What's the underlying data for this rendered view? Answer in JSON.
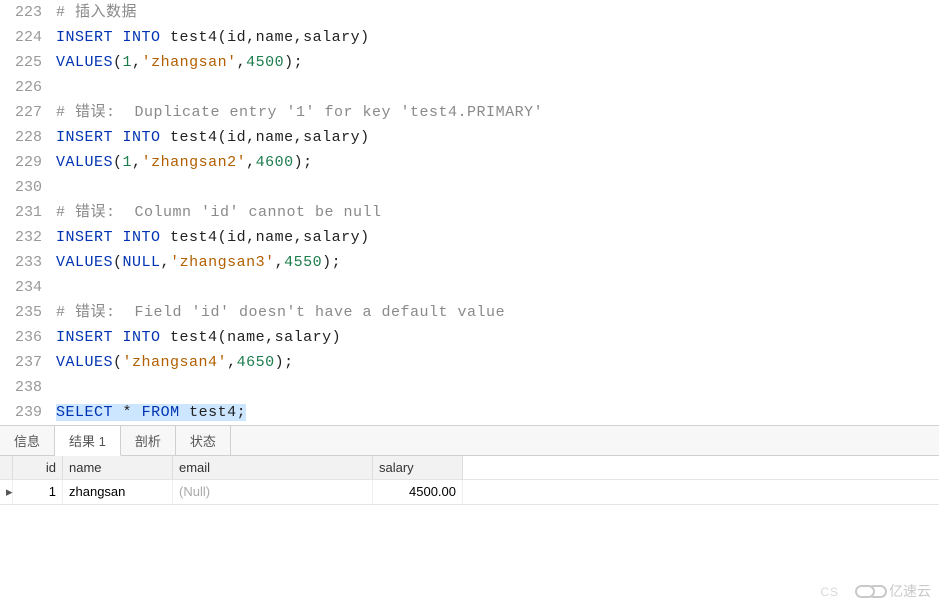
{
  "lines": [
    {
      "n": 223,
      "tokens": [
        {
          "t": "# 插入数据",
          "c": "cmt"
        }
      ]
    },
    {
      "n": 224,
      "tokens": [
        {
          "t": "INSERT",
          "c": "kw"
        },
        {
          "t": " ",
          "c": "pn"
        },
        {
          "t": "INTO",
          "c": "kw"
        },
        {
          "t": " test4",
          "c": "id"
        },
        {
          "t": "(",
          "c": "pn"
        },
        {
          "t": "id",
          "c": "id"
        },
        {
          "t": ",",
          "c": "pn"
        },
        {
          "t": "name",
          "c": "id"
        },
        {
          "t": ",",
          "c": "pn"
        },
        {
          "t": "salary",
          "c": "id"
        },
        {
          "t": ")",
          "c": "pn"
        }
      ]
    },
    {
      "n": 225,
      "tokens": [
        {
          "t": "VALUES",
          "c": "kw"
        },
        {
          "t": "(",
          "c": "pn"
        },
        {
          "t": "1",
          "c": "num"
        },
        {
          "t": ",",
          "c": "pn"
        },
        {
          "t": "'zhangsan'",
          "c": "str"
        },
        {
          "t": ",",
          "c": "pn"
        },
        {
          "t": "4500",
          "c": "num"
        },
        {
          "t": ");",
          "c": "pn"
        }
      ]
    },
    {
      "n": 226,
      "tokens": []
    },
    {
      "n": 227,
      "tokens": [
        {
          "t": "# 错误:  Duplicate entry '1' for key 'test4.PRIMARY'",
          "c": "cmt"
        }
      ]
    },
    {
      "n": 228,
      "tokens": [
        {
          "t": "INSERT",
          "c": "kw"
        },
        {
          "t": " ",
          "c": "pn"
        },
        {
          "t": "INTO",
          "c": "kw"
        },
        {
          "t": " test4",
          "c": "id"
        },
        {
          "t": "(",
          "c": "pn"
        },
        {
          "t": "id",
          "c": "id"
        },
        {
          "t": ",",
          "c": "pn"
        },
        {
          "t": "name",
          "c": "id"
        },
        {
          "t": ",",
          "c": "pn"
        },
        {
          "t": "salary",
          "c": "id"
        },
        {
          "t": ")",
          "c": "pn"
        }
      ]
    },
    {
      "n": 229,
      "tokens": [
        {
          "t": "VALUES",
          "c": "kw"
        },
        {
          "t": "(",
          "c": "pn"
        },
        {
          "t": "1",
          "c": "num"
        },
        {
          "t": ",",
          "c": "pn"
        },
        {
          "t": "'zhangsan2'",
          "c": "str"
        },
        {
          "t": ",",
          "c": "pn"
        },
        {
          "t": "4600",
          "c": "num"
        },
        {
          "t": ");",
          "c": "pn"
        }
      ]
    },
    {
      "n": 230,
      "tokens": []
    },
    {
      "n": 231,
      "tokens": [
        {
          "t": "# 错误:  Column 'id' cannot be null",
          "c": "cmt"
        }
      ]
    },
    {
      "n": 232,
      "tokens": [
        {
          "t": "INSERT",
          "c": "kw"
        },
        {
          "t": " ",
          "c": "pn"
        },
        {
          "t": "INTO",
          "c": "kw"
        },
        {
          "t": " test4",
          "c": "id"
        },
        {
          "t": "(",
          "c": "pn"
        },
        {
          "t": "id",
          "c": "id"
        },
        {
          "t": ",",
          "c": "pn"
        },
        {
          "t": "name",
          "c": "id"
        },
        {
          "t": ",",
          "c": "pn"
        },
        {
          "t": "salary",
          "c": "id"
        },
        {
          "t": ")",
          "c": "pn"
        }
      ]
    },
    {
      "n": 233,
      "tokens": [
        {
          "t": "VALUES",
          "c": "kw"
        },
        {
          "t": "(",
          "c": "pn"
        },
        {
          "t": "NULL",
          "c": "kw"
        },
        {
          "t": ",",
          "c": "pn"
        },
        {
          "t": "'zhangsan3'",
          "c": "str"
        },
        {
          "t": ",",
          "c": "pn"
        },
        {
          "t": "4550",
          "c": "num"
        },
        {
          "t": ");",
          "c": "pn"
        }
      ]
    },
    {
      "n": 234,
      "tokens": []
    },
    {
      "n": 235,
      "tokens": [
        {
          "t": "# 错误:  Field 'id' doesn't have a default value",
          "c": "cmt"
        }
      ]
    },
    {
      "n": 236,
      "tokens": [
        {
          "t": "INSERT",
          "c": "kw"
        },
        {
          "t": " ",
          "c": "pn"
        },
        {
          "t": "INTO",
          "c": "kw"
        },
        {
          "t": " test4",
          "c": "id"
        },
        {
          "t": "(",
          "c": "pn"
        },
        {
          "t": "name",
          "c": "id"
        },
        {
          "t": ",",
          "c": "pn"
        },
        {
          "t": "salary",
          "c": "id"
        },
        {
          "t": ")",
          "c": "pn"
        }
      ]
    },
    {
      "n": 237,
      "tokens": [
        {
          "t": "VALUES",
          "c": "kw"
        },
        {
          "t": "(",
          "c": "pn"
        },
        {
          "t": "'zhangsan4'",
          "c": "str"
        },
        {
          "t": ",",
          "c": "pn"
        },
        {
          "t": "4650",
          "c": "num"
        },
        {
          "t": ");",
          "c": "pn"
        }
      ]
    },
    {
      "n": 238,
      "tokens": []
    },
    {
      "n": 239,
      "tokens": [
        {
          "t": "SELECT",
          "c": "kw",
          "s": true
        },
        {
          "t": " ",
          "c": "pn",
          "s": true
        },
        {
          "t": "*",
          "c": "pn",
          "s": true
        },
        {
          "t": " ",
          "c": "pn",
          "s": true
        },
        {
          "t": "FROM",
          "c": "kw",
          "s": true
        },
        {
          "t": " test4",
          "c": "id",
          "s": true
        },
        {
          "t": ";",
          "c": "pn",
          "s": true
        }
      ]
    }
  ],
  "tabs": {
    "items": [
      "信息",
      "结果 1",
      "剖析",
      "状态"
    ],
    "activeIndex": 1
  },
  "grid": {
    "headers": [
      "id",
      "name",
      "email",
      "salary"
    ],
    "rows": [
      {
        "id": "1",
        "name": "zhangsan",
        "email": "(Null)",
        "salary": "4500.00"
      }
    ]
  },
  "watermark": "亿速云",
  "csdn": "CS"
}
